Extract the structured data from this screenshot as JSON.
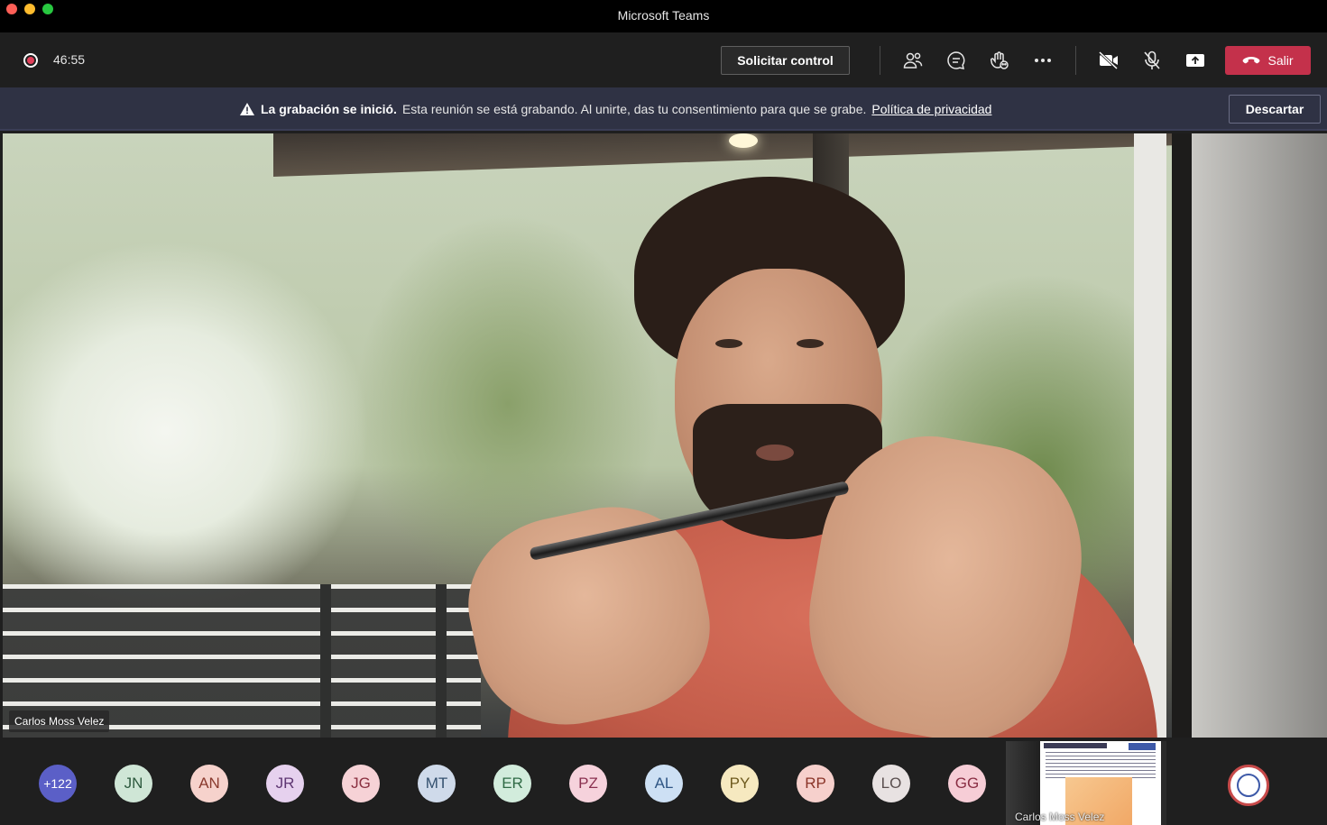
{
  "window": {
    "title": "Microsoft Teams"
  },
  "toolbar": {
    "timer": "46:55",
    "request_control_label": "Solicitar control",
    "leave_label": "Salir"
  },
  "banner": {
    "title": "La grabación se inició.",
    "message": "Esta reunión se está grabando. Al unirte, das tu consentimiento para que se grabe.",
    "link_label": "Política de privacidad",
    "dismiss_label": "Descartar"
  },
  "video": {
    "speaker_name": "Carlos Moss Velez"
  },
  "participants": {
    "overflow_count": "+122",
    "avatars": [
      {
        "initials": "JN",
        "bg": "#cfe6d6",
        "fg": "#2e5a3f"
      },
      {
        "initials": "AN",
        "bg": "#f6d2cc",
        "fg": "#8a3a2e"
      },
      {
        "initials": "JR",
        "bg": "#e6d1ee",
        "fg": "#5e3672"
      },
      {
        "initials": "JG",
        "bg": "#f6d2d6",
        "fg": "#8a3040"
      },
      {
        "initials": "MT",
        "bg": "#cfdaea",
        "fg": "#34506e"
      },
      {
        "initials": "ER",
        "bg": "#d2ecdc",
        "fg": "#2f6a45"
      },
      {
        "initials": "PZ",
        "bg": "#f6d2dc",
        "fg": "#8a3050"
      },
      {
        "initials": "AL",
        "bg": "#cde0f4",
        "fg": "#2f5684"
      },
      {
        "initials": "PY",
        "bg": "#f6e9c0",
        "fg": "#6e5a1e"
      },
      {
        "initials": "RP",
        "bg": "#f6d0cc",
        "fg": "#8a3428"
      },
      {
        "initials": "LO",
        "bg": "#e8e2e2",
        "fg": "#5a4f4f"
      },
      {
        "initials": "GG",
        "bg": "#f6cdd6",
        "fg": "#8a2e44"
      }
    ],
    "share_thumbnail_label": "Carlos Moss Velez"
  },
  "icons": {
    "record": "record-icon",
    "participants": "people-icon",
    "chat": "chat-icon",
    "reactions": "raise-hand-icon",
    "more": "more-icon",
    "camera": "camera-off-icon",
    "mic": "mic-off-icon",
    "share": "share-screen-icon",
    "phone": "phone-hangup-icon",
    "warning": "warning-icon"
  },
  "colors": {
    "leave": "#c4314b",
    "banner_bg": "#2f3244",
    "overflow_badge": "#5b5fc7"
  }
}
